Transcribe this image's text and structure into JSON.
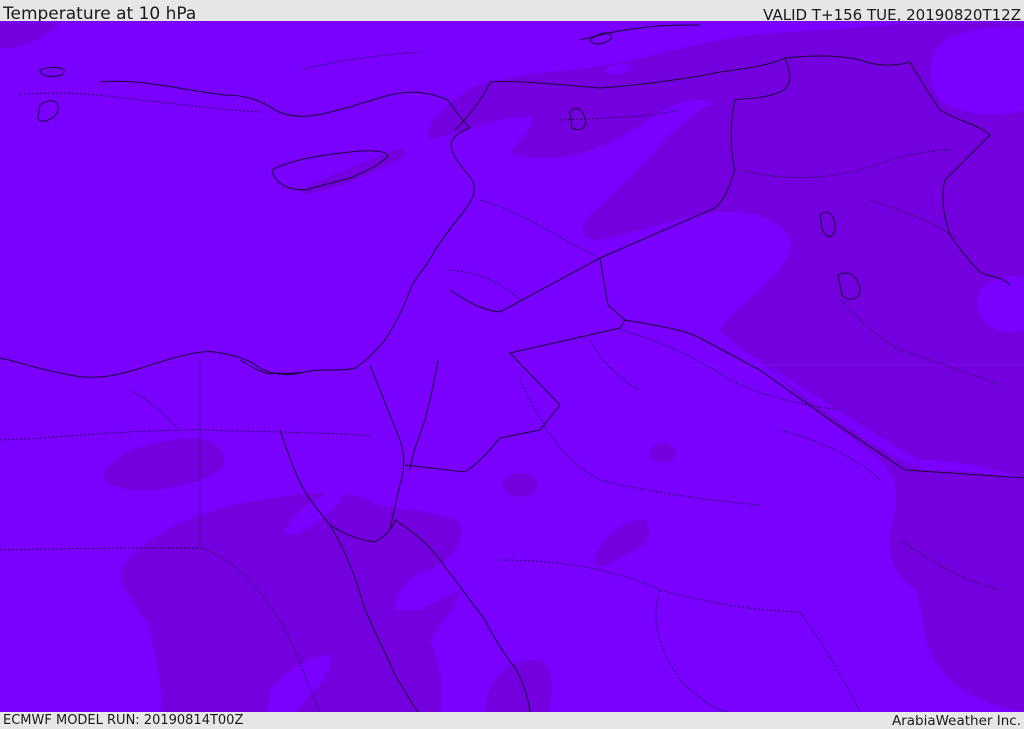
{
  "header": {
    "title": "Temperature at 10 hPa",
    "valid": "VALID T+156 TUE, 20190820T12Z"
  },
  "footer": {
    "model_run": "ECMWF MODEL RUN: 20190814T00Z",
    "credit": "ArabiaWeather Inc."
  },
  "colors": {
    "field_light": "#7a00ff",
    "field_dark": "#7400df",
    "border": "#1a0a3a",
    "frame": "#e6e6e6"
  },
  "map": {
    "variable": "temperature",
    "level": "10 hPa",
    "region": "Eastern Mediterranean / Middle East"
  }
}
